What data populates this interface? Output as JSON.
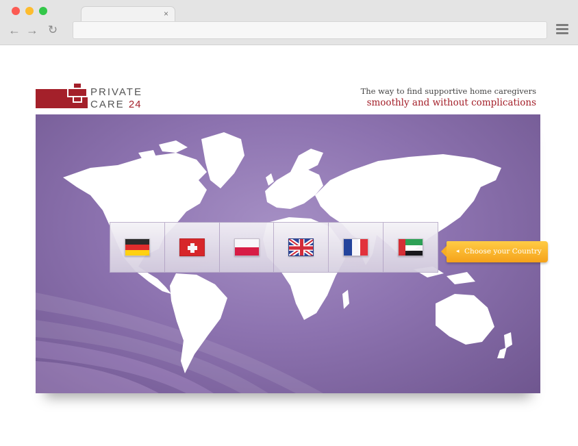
{
  "browser": {
    "tab_close": "×",
    "back_icon": "←",
    "forward_icon": "→",
    "reload_icon": "↻"
  },
  "logo": {
    "line1": "PRIVATE",
    "line2_word": "CARE",
    "line2_number": "24"
  },
  "tagline": {
    "line1": "The way to find supportive home caregivers",
    "line2": "smoothly and without complications"
  },
  "flags": [
    {
      "country": "Germany",
      "icon": "german-flag-icon"
    },
    {
      "country": "Switzerland",
      "icon": "swiss-flag-icon"
    },
    {
      "country": "Poland",
      "icon": "polish-flag-icon"
    },
    {
      "country": "United Kingdom",
      "icon": "uk-flag-icon"
    },
    {
      "country": "France",
      "icon": "french-flag-icon"
    },
    {
      "country": "United Arab Emirates",
      "icon": "uae-flag-icon"
    }
  ],
  "cta": {
    "label": "Choose your Country",
    "arrow": "◂"
  },
  "colors": {
    "brand_red": "#a4202a",
    "map_purple": "#8d73b0",
    "cta_orange": "#f5a21a"
  }
}
